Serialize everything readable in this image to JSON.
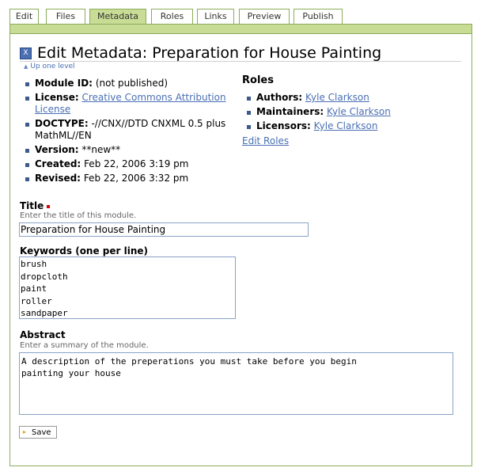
{
  "tabs": [
    "Edit",
    "Files",
    "Metadata",
    "Roles",
    "Links",
    "Preview",
    "Publish"
  ],
  "active_tab": "Metadata",
  "colors": {
    "accent": "#c8dc96",
    "border": "#8cac5a",
    "link": "#4a6fb3",
    "bullet": "#3d5a8a",
    "required": "#e00000"
  },
  "header": {
    "icon": "x-document-icon",
    "title": "Edit Metadata: Preparation for House Painting",
    "up_link": "Up one level"
  },
  "details": {
    "module_id_label": "Module ID:",
    "module_id_value": "(not published)",
    "license_label": "License:",
    "license_value": "Creative Commons Attribution License",
    "doctype_label": "DOCTYPE:",
    "doctype_value": "-//CNX//DTD CNXML 0.5 plus MathML//EN",
    "version_label": "Version:",
    "version_value": "**new**",
    "created_label": "Created:",
    "created_value": "Feb 22, 2006 3:19 pm",
    "revised_label": "Revised:",
    "revised_value": "Feb 22, 2006 3:32 pm"
  },
  "roles": {
    "heading": "Roles",
    "authors_label": "Authors:",
    "authors_value": "Kyle Clarkson",
    "maintainers_label": "Maintainers:",
    "maintainers_value": "Kyle Clarkson",
    "licensors_label": "Licensors:",
    "licensors_value": "Kyle Clarkson",
    "edit_link": "Edit Roles"
  },
  "form": {
    "title_label": "Title",
    "title_help": "Enter the title of this module.",
    "title_value": "Preparation for House Painting",
    "keywords_label": "Keywords (one per line)",
    "keywords": [
      "brush",
      "dropcloth",
      "paint",
      "roller",
      "sandpaper"
    ],
    "abstract_label": "Abstract",
    "abstract_help": "Enter a summary of the module.",
    "abstract_line1": "A description of the preperations you must take before you begin",
    "abstract_line2": "painting your house",
    "save_label": "Save"
  }
}
